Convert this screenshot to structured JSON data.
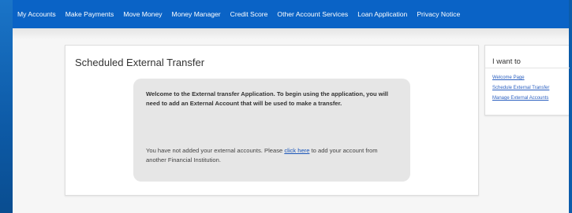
{
  "nav": {
    "items": [
      {
        "label": "My Accounts"
      },
      {
        "label": "Make Payments"
      },
      {
        "label": "Move Money"
      },
      {
        "label": "Money Manager"
      },
      {
        "label": "Credit Score"
      },
      {
        "label": "Other Account Services"
      },
      {
        "label": "Loan Application"
      },
      {
        "label": "Privacy Notice"
      }
    ]
  },
  "main": {
    "title": "Scheduled External Transfer",
    "welcome_text": "Welcome to the External transfer Application. To begin using the application, you will need to add an External Account that will be used to make a transfer.",
    "notice_before": "You have not added your external accounts. Please ",
    "notice_link": "click here",
    "notice_after": " to add your account from another Financial Institution."
  },
  "sidebar": {
    "title": "I want to",
    "links": [
      {
        "label": "Welcome Page"
      },
      {
        "label": "Schedule External Transfer"
      },
      {
        "label": "Manage External Accounts"
      }
    ]
  }
}
